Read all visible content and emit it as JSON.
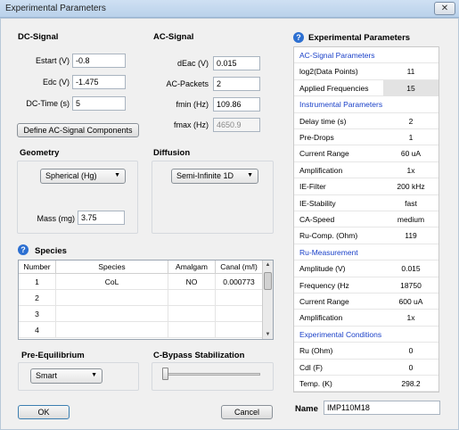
{
  "window": {
    "title": "Experimental Parameters",
    "close_glyph": "✕"
  },
  "dc_signal": {
    "header": "DC-Signal",
    "estart_label": "Estart (V)",
    "estart": "-0.8",
    "edc_label": "Edc (V)",
    "edc": "-1.475",
    "dctime_label": "DC-Time (s)",
    "dctime": "5",
    "define_button": "Define AC-Signal Components"
  },
  "ac_signal": {
    "header": "AC-Signal",
    "deac_label": "dEac (V)",
    "deac": "0.015",
    "packets_label": "AC-Packets",
    "packets": "2",
    "fmin_label": "fmin (Hz)",
    "fmin": "109.86",
    "fmax_label": "fmax (Hz)",
    "fmax": "4650.9"
  },
  "geometry": {
    "header": "Geometry",
    "selected": "Spherical (Hg)",
    "mass_label": "Mass (mg)",
    "mass": "3.75"
  },
  "diffusion": {
    "header": "Diffusion",
    "selected": "Semi-Infinite 1D"
  },
  "species": {
    "header": "Species",
    "columns": [
      "Number",
      "Species",
      "Amalgam",
      "Canal (m/l)"
    ],
    "rows": [
      {
        "number": "1",
        "species": "CoL",
        "amalgam": "NO",
        "canal": "0.000773"
      },
      {
        "number": "2",
        "species": "",
        "amalgam": "",
        "canal": ""
      },
      {
        "number": "3",
        "species": "",
        "amalgam": "",
        "canal": ""
      },
      {
        "number": "4",
        "species": "",
        "amalgam": "",
        "canal": ""
      }
    ]
  },
  "pre_equilibrium": {
    "header": "Pre-Equilibrium",
    "selected": "Smart"
  },
  "cbypass": {
    "header": "C-Bypass Stabilization",
    "level": 0
  },
  "buttons": {
    "ok": "OK",
    "cancel": "Cancel"
  },
  "params": {
    "header": "Experimental Parameters",
    "rows": [
      {
        "key": "AC-Signal Parameters",
        "value": "",
        "section": true
      },
      {
        "key": "log2(Data Points)",
        "value": "11"
      },
      {
        "key": "Applied Frequencies",
        "value": "15",
        "shaded": true
      },
      {
        "key": "Instrumental Parameters",
        "value": "",
        "section": true
      },
      {
        "key": "Delay time (s)",
        "value": "2"
      },
      {
        "key": "Pre-Drops",
        "value": "1"
      },
      {
        "key": "Current Range",
        "value": "60 uA"
      },
      {
        "key": "Amplification",
        "value": "1x"
      },
      {
        "key": "IE-Filter",
        "value": "200 kHz"
      },
      {
        "key": "IE-Stability",
        "value": "fast"
      },
      {
        "key": "CA-Speed",
        "value": "medium"
      },
      {
        "key": "Ru-Comp. (Ohm)",
        "value": "119"
      },
      {
        "key": "Ru-Measurement",
        "value": "",
        "section": true
      },
      {
        "key": "Amplitude (V)",
        "value": "0.015"
      },
      {
        "key": "Frequency (Hz",
        "value": "18750"
      },
      {
        "key": "Current Range",
        "value": "600 uA"
      },
      {
        "key": "Amplification",
        "value": "1x"
      },
      {
        "key": "Experimental Conditions",
        "value": "",
        "section": true
      },
      {
        "key": "Ru (Ohm)",
        "value": "0"
      },
      {
        "key": "Cdl (F)",
        "value": "0"
      },
      {
        "key": "Temp. (K)",
        "value": "298.2"
      }
    ]
  },
  "name_field": {
    "label": "Name",
    "value": "IMP110M18"
  }
}
